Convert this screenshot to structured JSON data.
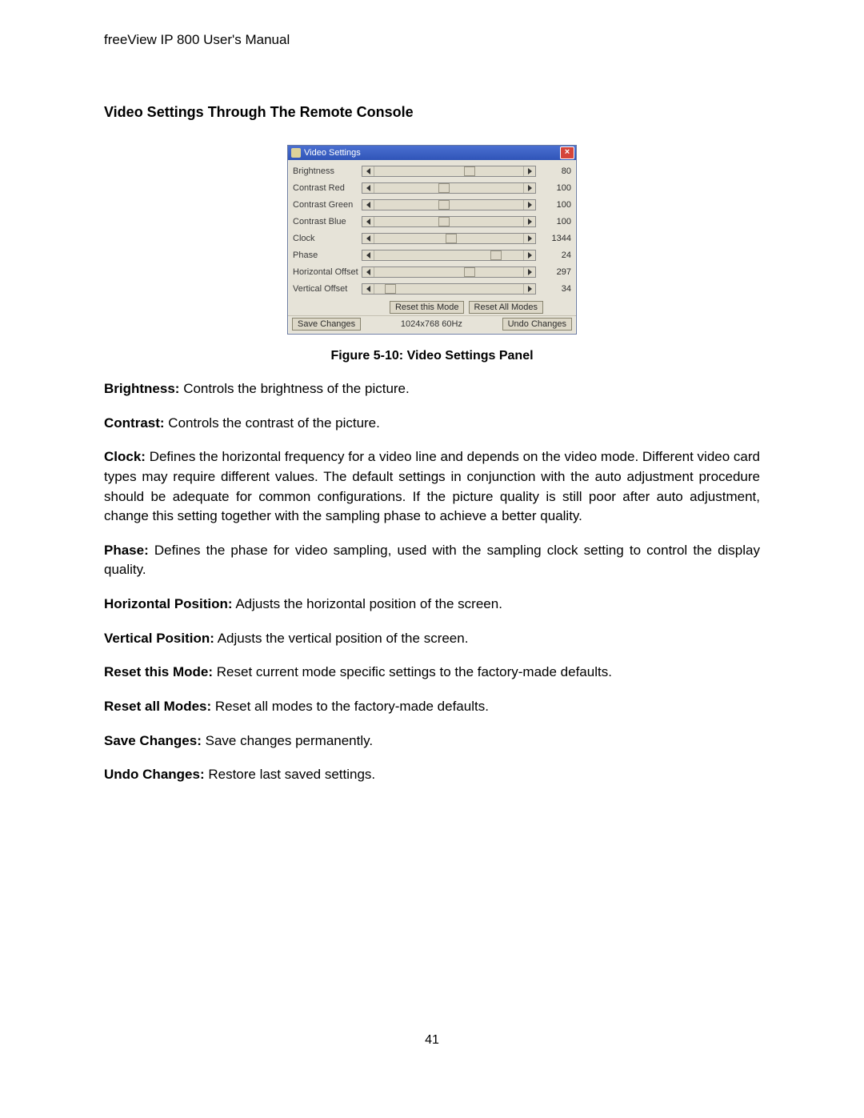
{
  "doc": {
    "header": "freeView IP 800 User's Manual",
    "section_heading": "Video Settings Through The Remote Console",
    "figure_caption": "Figure 5-10: Video Settings Panel",
    "page_number": "41"
  },
  "dialog": {
    "title": "Video Settings",
    "close_glyph": "×",
    "reset_this_mode": "Reset this Mode",
    "reset_all_modes": "Reset All Modes",
    "save_changes": "Save Changes",
    "undo_changes": "Undo Changes",
    "resolution": "1024x768 60Hz",
    "rows": [
      {
        "label": "Brightness",
        "value": "80",
        "thumb_pct": 60
      },
      {
        "label": "Contrast Red",
        "value": "100",
        "thumb_pct": 43
      },
      {
        "label": "Contrast Green",
        "value": "100",
        "thumb_pct": 43
      },
      {
        "label": "Contrast Blue",
        "value": "100",
        "thumb_pct": 43
      },
      {
        "label": "Clock",
        "value": "1344",
        "thumb_pct": 48
      },
      {
        "label": "Phase",
        "value": "24",
        "thumb_pct": 78
      },
      {
        "label": "Horizontal Offset",
        "value": "297",
        "thumb_pct": 60
      },
      {
        "label": "Vertical Offset",
        "value": "34",
        "thumb_pct": 7
      }
    ]
  },
  "descriptions": [
    {
      "term": "Brightness:",
      "text": " Controls the brightness of the picture."
    },
    {
      "term": "Contrast:",
      "text": " Controls the contrast of the picture."
    },
    {
      "term": "Clock:",
      "text": " Defines the horizontal frequency for a video line and depends on the video mode. Different video card types may require different values. The default settings in conjunction with the auto adjustment procedure should be adequate for common configurations. If the picture quality is still poor after auto adjustment, change this setting together with the sampling phase to achieve a better quality."
    },
    {
      "term": "Phase:",
      "text": " Defines the phase for video sampling, used with the sampling clock setting to control the display quality."
    },
    {
      "term": "Horizontal Position:",
      "text": " Adjusts the horizontal position of the screen."
    },
    {
      "term": "Vertical Position:",
      "text": " Adjusts the vertical position of the screen."
    },
    {
      "term": "Reset this Mode:",
      "text": " Reset current mode specific settings to the factory-made defaults."
    },
    {
      "term": "Reset all Modes:",
      "text": " Reset all modes to the factory-made defaults."
    },
    {
      "term": "Save Changes:",
      "text": " Save changes permanently."
    },
    {
      "term": "Undo Changes:",
      "text": " Restore last saved settings."
    }
  ]
}
